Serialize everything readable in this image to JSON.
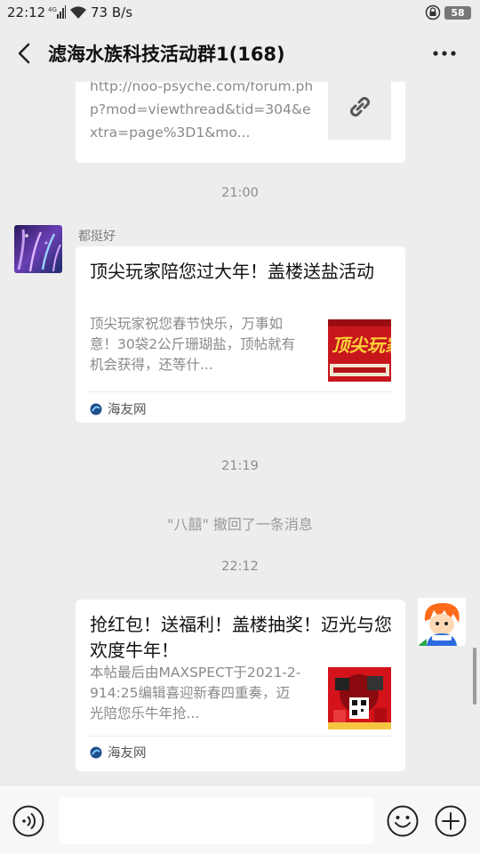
{
  "status_bar": {
    "time": "22:12",
    "network_speed": "73 B/s",
    "battery": "58",
    "icons": [
      "signal-4g-icon",
      "wifi-icon",
      "lock-rotation-icon",
      "battery-icon"
    ]
  },
  "header": {
    "title": "滤海水族科技活动群1(168)",
    "back_icon": "chevron-left-icon",
    "more_icon": "more-dots-icon"
  },
  "messages": {
    "link_message": {
      "url_text": "http://noo-psyche.com/forum.php?mod=viewthread&tid=304&extra=page%3D1&mo...",
      "icon": "link-icon"
    },
    "time_1": "21:00",
    "article_1": {
      "sender": "都挺好",
      "title": "顶尖玩家陪您过大年！盖楼送盐活动",
      "description": "顶尖玩家祝您春节快乐，万事如意！30袋2公斤珊瑚盐，顶帖就有机会获得，还等什...",
      "source": "海友网",
      "thumb_text": "顶尖玩家"
    },
    "time_2": "21:19",
    "recall_notice": "\"八囍\" 撤回了一条消息",
    "time_3": "22:12",
    "article_2": {
      "title": "抢红包！送福利！盖楼抽奖！迈光与您欢度牛年！",
      "description": "本帖最后由MAXSPECT于2021-2-914:25编辑喜迎新春四重奏，迈光陪您乐牛年抢...",
      "source": "海友网"
    }
  },
  "input_bar": {
    "value": "",
    "icons": [
      "voice-icon",
      "emoji-icon",
      "plus-icon"
    ]
  }
}
